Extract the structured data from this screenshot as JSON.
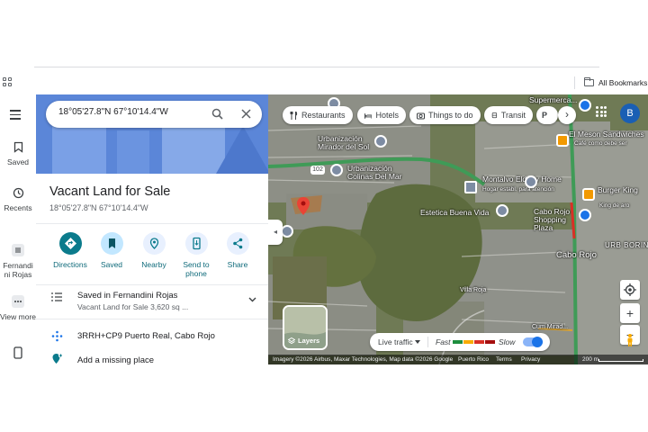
{
  "bookmarks": {
    "all_bookmarks": "All Bookmarks"
  },
  "rail": {
    "saved": "Saved",
    "recents": "Recents",
    "list_name": "Fernandi ni Rojas",
    "view_more": "View more"
  },
  "search": {
    "value": "18°05'27.8\"N 67°10'14.4\"W"
  },
  "place": {
    "title": "Vacant Land for Sale",
    "coords": "18°05'27.8\"N 67°10'14.4\"W"
  },
  "actions": {
    "directions": "Directions",
    "saved": "Saved",
    "nearby": "Nearby",
    "send_to_phone": "Send to phone",
    "share": "Share"
  },
  "saved_in": {
    "title": "Saved in Fernandini Rojas",
    "detail": "Vacant Land for Sale 3,620 sq ..."
  },
  "plus_code": "3RRH+CP9 Puerto Real, Cabo Rojo",
  "add_missing": "Add a missing place",
  "chips": [
    "Restaurants",
    "Hotels",
    "Things to do",
    "Transit",
    "P"
  ],
  "account_initial": "B",
  "map_labels": {
    "supermarket": "Supermerca...",
    "mirador": "Urbanización Mirador del Sol",
    "colinas": "Urbanización Colinas Del Mar",
    "montalvo": "Montalvo Elderly Home",
    "montalvo_sub": "Hogar establ. para atención",
    "estetica": "Estetica Buena Vida",
    "cabo_plaza": "Cabo Rojo Shopping Plaza",
    "cabo_rojo": "Cabo Rojo",
    "urb_borin": "URB BORIN",
    "meson": "El Meson Sandwiches",
    "meson_sub": "Café como debe ser",
    "burger": "Burger King",
    "burger_sub": "King de aro",
    "villa": "Villa Roja",
    "cuma": "Cum Mirad...",
    "road": "102"
  },
  "layers_label": "Layers",
  "traffic": {
    "label": "Live traffic",
    "fast": "Fast",
    "slow": "Slow"
  },
  "attribution": {
    "imagery": "Imagery ©2026 Airbus, Maxar Technologies, Map data ©2026 Google",
    "region": "Puerto Rico",
    "terms": "Terms",
    "privacy": "Privacy",
    "scale": "200 m"
  },
  "colors": {
    "accent": "#1a73e8",
    "action_teal": "#0b7b8c",
    "pin": "#ea4335",
    "traffic_fast": "#1e8e3e",
    "traffic_slow": "#a50e0e"
  }
}
